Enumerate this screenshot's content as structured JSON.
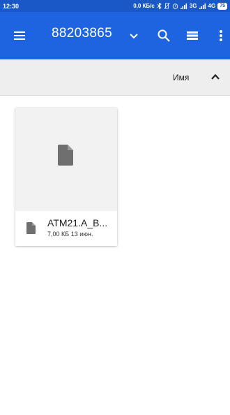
{
  "status_bar": {
    "time": "12:30",
    "speed": "0,0 КБ/с",
    "network_1": "3G",
    "network_2": "4G",
    "battery": "75"
  },
  "app_bar": {
    "title": "88203865",
    "icons": [
      "menu-icon",
      "chevron-down-icon",
      "search-icon",
      "list-view-icon",
      "more-vert-icon"
    ]
  },
  "sort": {
    "label": "Имя",
    "direction_icon": "arrow-up-icon"
  },
  "files": [
    {
      "name": "ATM21.A_B...",
      "size": "7,00 КБ",
      "date": "13 июн.",
      "icon": "file-icon"
    }
  ],
  "colors": {
    "status_bar": "#1a57c7",
    "app_bar": "#1e63e0",
    "sort_bar": "#eeeeee",
    "thumbnail_bg": "#f2f2f2",
    "file_icon": "#6f6f6f"
  }
}
